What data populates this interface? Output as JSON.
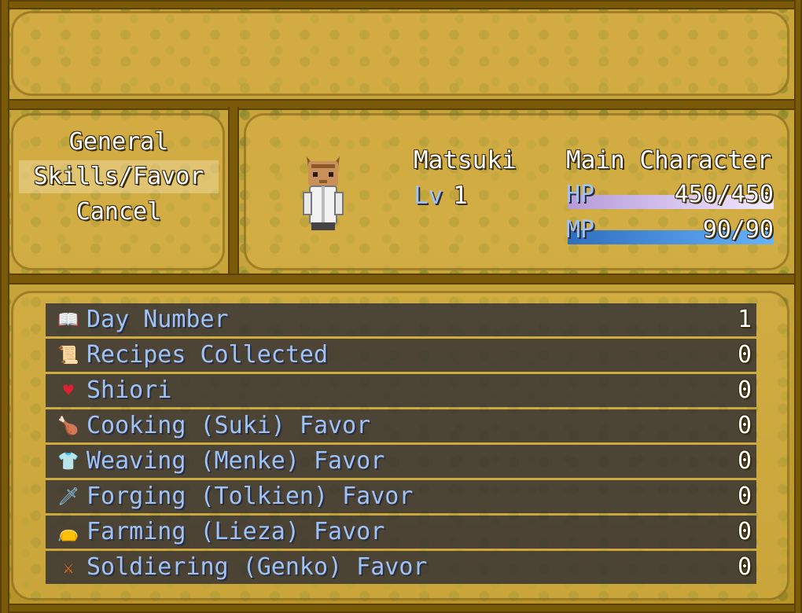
{
  "menu": {
    "items": [
      {
        "label": "General"
      },
      {
        "label": "Skills/Favor"
      },
      {
        "label": "Cancel"
      }
    ],
    "selected_index": 1
  },
  "actor": {
    "name": "Matsuki",
    "level_label": "Lv",
    "level": "1",
    "class": "Main Character",
    "hp_label": "HP",
    "hp_text": "450/450",
    "hp_fraction": 1.0,
    "mp_label": "MP",
    "mp_text": "90/90",
    "mp_fraction": 1.0
  },
  "stats": [
    {
      "icon": "book-icon",
      "label": "Day Number",
      "value": "1"
    },
    {
      "icon": "scroll-icon",
      "label": "Recipes Collected",
      "value": "0"
    },
    {
      "icon": "heart-icon",
      "label": "Shiori",
      "value": "0"
    },
    {
      "icon": "drumstick-icon",
      "label": "Cooking (Suki) Favor",
      "value": "0"
    },
    {
      "icon": "shirt-icon",
      "label": "Weaving (Menke) Favor",
      "value": "0"
    },
    {
      "icon": "sword-icon",
      "label": "Forging (Tolkien) Favor",
      "value": "0"
    },
    {
      "icon": "sack-icon",
      "label": "Farming (Lieza) Favor",
      "value": "0"
    },
    {
      "icon": "soldier-icon",
      "label": "Soldiering (Genko) Favor",
      "value": "0"
    }
  ],
  "colors": {
    "hp_gradient": [
      "#b59bd9",
      "#f2e9ff"
    ],
    "mp_gradient": [
      "#2f6fc0",
      "#66b3ff"
    ],
    "label_blue": "#9fc2f5"
  }
}
